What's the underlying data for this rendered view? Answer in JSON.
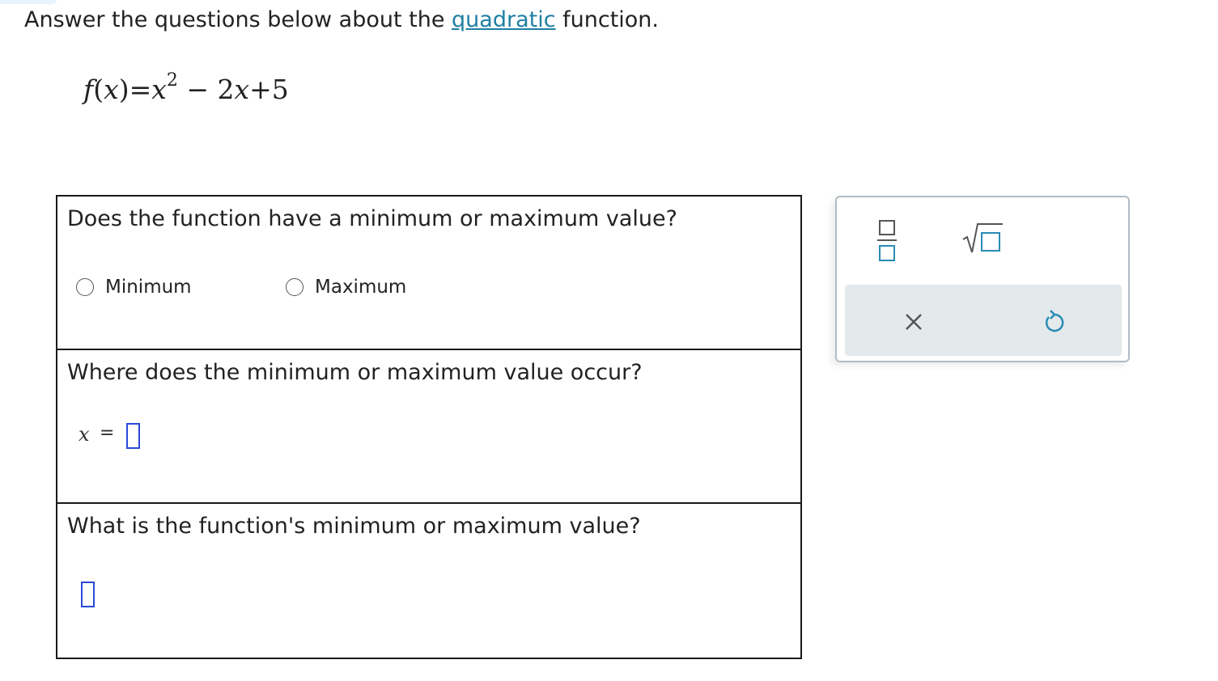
{
  "prompt": {
    "before": "Answer the questions below about the ",
    "link": "quadratic",
    "after": " function."
  },
  "formula": {
    "f": "f",
    "open": "(",
    "x": "x",
    "close": ")",
    "eq": "=",
    "x2": "x",
    "exp": "2",
    "rest1": " − 2",
    "x3": "x",
    "rest2": "+5"
  },
  "questions": {
    "q1": {
      "text": "Does the function have a minimum or maximum value?",
      "options": [
        "Minimum",
        "Maximum"
      ]
    },
    "q2": {
      "text": "Where does the minimum or maximum value occur?",
      "var": "x",
      "eq": "="
    },
    "q3": {
      "text": "What is the function's minimum or maximum value?"
    }
  },
  "palette": {
    "icons": [
      "fraction-icon",
      "square-root-icon",
      "clear-icon",
      "undo-icon"
    ],
    "accent": "#2a8cb5"
  },
  "colors": {
    "link": "#1f7fa3",
    "answer_box": "#2a49d8",
    "palette_bg": "#e4e9ec"
  }
}
